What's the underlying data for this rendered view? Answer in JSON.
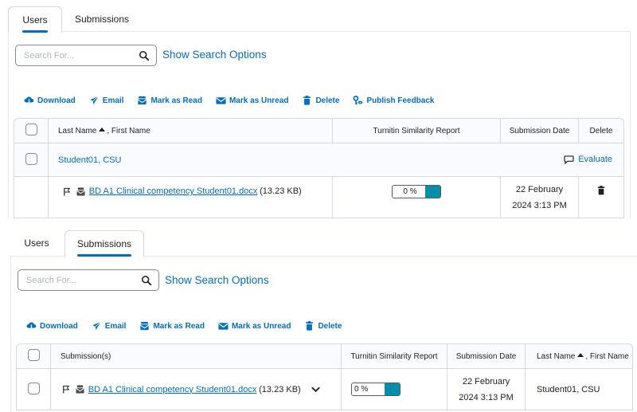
{
  "colors": {
    "accent": "#006fbf",
    "turnitin_bar": "#008eab",
    "border": "#d3d9e3"
  },
  "users_view": {
    "tabs": [
      {
        "label": "Users",
        "active": true
      },
      {
        "label": "Submissions",
        "active": false
      }
    ],
    "search": {
      "placeholder": "Search For...",
      "value": "",
      "show_options_label": "Show Search Options",
      "icon": "search-icon"
    },
    "toolbar": [
      {
        "label": "Download",
        "icon": "download-icon"
      },
      {
        "label": "Email",
        "icon": "email-icon"
      },
      {
        "label": "Mark as Read",
        "icon": "mark-read-icon"
      },
      {
        "label": "Mark as Unread",
        "icon": "mark-unread-icon"
      },
      {
        "label": "Delete",
        "icon": "delete-icon"
      },
      {
        "label": "Publish Feedback",
        "icon": "publish-feedback-icon"
      }
    ],
    "table": {
      "columns": {
        "name_last": "Last Name",
        "name_first": ", First Name",
        "turnitin": "Turnitin Similarity Report",
        "date": "Submission Date",
        "delete": "Delete"
      },
      "student": {
        "name": "Student01, CSU",
        "evaluate_label": "Evaluate"
      },
      "submission": {
        "file_name": "BD A1 Clinical competency Student01.docx",
        "file_size": "(13.23 KB)",
        "similarity": "0 %",
        "date_line1": "22 February",
        "date_line2": "2024 3:13 PM"
      }
    }
  },
  "submissions_view": {
    "tabs": [
      {
        "label": "Users",
        "active": false
      },
      {
        "label": "Submissions",
        "active": true
      }
    ],
    "search": {
      "placeholder": "Search For...",
      "value": "",
      "show_options_label": "Show Search Options",
      "icon": "search-icon"
    },
    "toolbar": [
      {
        "label": "Download",
        "icon": "download-icon"
      },
      {
        "label": "Email",
        "icon": "email-icon"
      },
      {
        "label": "Mark as Read",
        "icon": "mark-read-icon"
      },
      {
        "label": "Mark as Unread",
        "icon": "mark-unread-icon"
      },
      {
        "label": "Delete",
        "icon": "delete-icon"
      }
    ],
    "table": {
      "columns": {
        "submissions": "Submission(s)",
        "turnitin": "Turnitin Similarity Report",
        "date": "Submission Date",
        "name_last": "Last Name",
        "name_first": ", First Name"
      },
      "submission": {
        "file_name": "BD A1 Clinical competency Student01.docx",
        "file_size": "(13.23 KB)",
        "similarity": "0 %",
        "date_line1": "22 February",
        "date_line2": "2024 3:13 PM",
        "student": "Student01, CSU"
      }
    }
  }
}
